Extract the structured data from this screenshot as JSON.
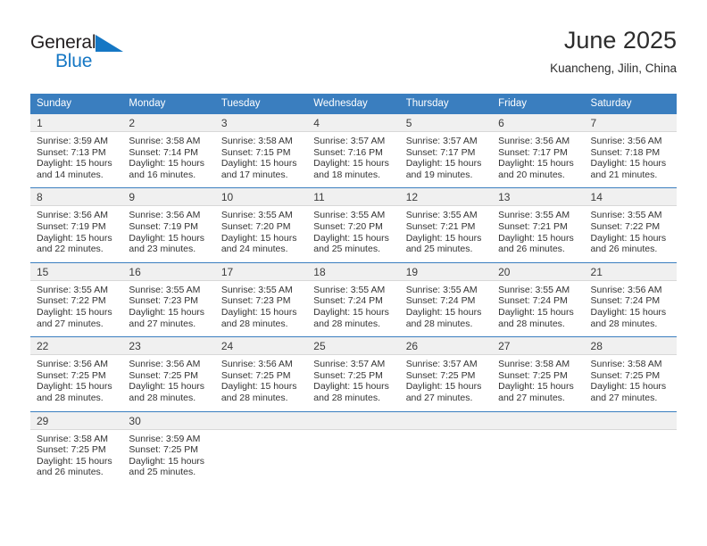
{
  "brand": {
    "name_top": "General",
    "name_bottom": "Blue",
    "triangle_color": "#1577c4",
    "text_color": "#231f20",
    "blue_color": "#1577c4"
  },
  "header": {
    "title": "June 2025",
    "subtitle": "Kuancheng, Jilin, China"
  },
  "colors": {
    "header_blue": "#3a7ebf",
    "daynum_bg": "#f0f0f0",
    "body_text": "#333333"
  },
  "calendar": {
    "weekday_headers": [
      "Sunday",
      "Monday",
      "Tuesday",
      "Wednesday",
      "Thursday",
      "Friday",
      "Saturday"
    ],
    "weeks": [
      {
        "days": [
          {
            "num": "1",
            "sunrise": "Sunrise: 3:59 AM",
            "sunset": "Sunset: 7:13 PM",
            "daylight1": "Daylight: 15 hours",
            "daylight2": "and 14 minutes."
          },
          {
            "num": "2",
            "sunrise": "Sunrise: 3:58 AM",
            "sunset": "Sunset: 7:14 PM",
            "daylight1": "Daylight: 15 hours",
            "daylight2": "and 16 minutes."
          },
          {
            "num": "3",
            "sunrise": "Sunrise: 3:58 AM",
            "sunset": "Sunset: 7:15 PM",
            "daylight1": "Daylight: 15 hours",
            "daylight2": "and 17 minutes."
          },
          {
            "num": "4",
            "sunrise": "Sunrise: 3:57 AM",
            "sunset": "Sunset: 7:16 PM",
            "daylight1": "Daylight: 15 hours",
            "daylight2": "and 18 minutes."
          },
          {
            "num": "5",
            "sunrise": "Sunrise: 3:57 AM",
            "sunset": "Sunset: 7:17 PM",
            "daylight1": "Daylight: 15 hours",
            "daylight2": "and 19 minutes."
          },
          {
            "num": "6",
            "sunrise": "Sunrise: 3:56 AM",
            "sunset": "Sunset: 7:17 PM",
            "daylight1": "Daylight: 15 hours",
            "daylight2": "and 20 minutes."
          },
          {
            "num": "7",
            "sunrise": "Sunrise: 3:56 AM",
            "sunset": "Sunset: 7:18 PM",
            "daylight1": "Daylight: 15 hours",
            "daylight2": "and 21 minutes."
          }
        ]
      },
      {
        "days": [
          {
            "num": "8",
            "sunrise": "Sunrise: 3:56 AM",
            "sunset": "Sunset: 7:19 PM",
            "daylight1": "Daylight: 15 hours",
            "daylight2": "and 22 minutes."
          },
          {
            "num": "9",
            "sunrise": "Sunrise: 3:56 AM",
            "sunset": "Sunset: 7:19 PM",
            "daylight1": "Daylight: 15 hours",
            "daylight2": "and 23 minutes."
          },
          {
            "num": "10",
            "sunrise": "Sunrise: 3:55 AM",
            "sunset": "Sunset: 7:20 PM",
            "daylight1": "Daylight: 15 hours",
            "daylight2": "and 24 minutes."
          },
          {
            "num": "11",
            "sunrise": "Sunrise: 3:55 AM",
            "sunset": "Sunset: 7:20 PM",
            "daylight1": "Daylight: 15 hours",
            "daylight2": "and 25 minutes."
          },
          {
            "num": "12",
            "sunrise": "Sunrise: 3:55 AM",
            "sunset": "Sunset: 7:21 PM",
            "daylight1": "Daylight: 15 hours",
            "daylight2": "and 25 minutes."
          },
          {
            "num": "13",
            "sunrise": "Sunrise: 3:55 AM",
            "sunset": "Sunset: 7:21 PM",
            "daylight1": "Daylight: 15 hours",
            "daylight2": "and 26 minutes."
          },
          {
            "num": "14",
            "sunrise": "Sunrise: 3:55 AM",
            "sunset": "Sunset: 7:22 PM",
            "daylight1": "Daylight: 15 hours",
            "daylight2": "and 26 minutes."
          }
        ]
      },
      {
        "days": [
          {
            "num": "15",
            "sunrise": "Sunrise: 3:55 AM",
            "sunset": "Sunset: 7:22 PM",
            "daylight1": "Daylight: 15 hours",
            "daylight2": "and 27 minutes."
          },
          {
            "num": "16",
            "sunrise": "Sunrise: 3:55 AM",
            "sunset": "Sunset: 7:23 PM",
            "daylight1": "Daylight: 15 hours",
            "daylight2": "and 27 minutes."
          },
          {
            "num": "17",
            "sunrise": "Sunrise: 3:55 AM",
            "sunset": "Sunset: 7:23 PM",
            "daylight1": "Daylight: 15 hours",
            "daylight2": "and 28 minutes."
          },
          {
            "num": "18",
            "sunrise": "Sunrise: 3:55 AM",
            "sunset": "Sunset: 7:24 PM",
            "daylight1": "Daylight: 15 hours",
            "daylight2": "and 28 minutes."
          },
          {
            "num": "19",
            "sunrise": "Sunrise: 3:55 AM",
            "sunset": "Sunset: 7:24 PM",
            "daylight1": "Daylight: 15 hours",
            "daylight2": "and 28 minutes."
          },
          {
            "num": "20",
            "sunrise": "Sunrise: 3:55 AM",
            "sunset": "Sunset: 7:24 PM",
            "daylight1": "Daylight: 15 hours",
            "daylight2": "and 28 minutes."
          },
          {
            "num": "21",
            "sunrise": "Sunrise: 3:56 AM",
            "sunset": "Sunset: 7:24 PM",
            "daylight1": "Daylight: 15 hours",
            "daylight2": "and 28 minutes."
          }
        ]
      },
      {
        "days": [
          {
            "num": "22",
            "sunrise": "Sunrise: 3:56 AM",
            "sunset": "Sunset: 7:25 PM",
            "daylight1": "Daylight: 15 hours",
            "daylight2": "and 28 minutes."
          },
          {
            "num": "23",
            "sunrise": "Sunrise: 3:56 AM",
            "sunset": "Sunset: 7:25 PM",
            "daylight1": "Daylight: 15 hours",
            "daylight2": "and 28 minutes."
          },
          {
            "num": "24",
            "sunrise": "Sunrise: 3:56 AM",
            "sunset": "Sunset: 7:25 PM",
            "daylight1": "Daylight: 15 hours",
            "daylight2": "and 28 minutes."
          },
          {
            "num": "25",
            "sunrise": "Sunrise: 3:57 AM",
            "sunset": "Sunset: 7:25 PM",
            "daylight1": "Daylight: 15 hours",
            "daylight2": "and 28 minutes."
          },
          {
            "num": "26",
            "sunrise": "Sunrise: 3:57 AM",
            "sunset": "Sunset: 7:25 PM",
            "daylight1": "Daylight: 15 hours",
            "daylight2": "and 27 minutes."
          },
          {
            "num": "27",
            "sunrise": "Sunrise: 3:58 AM",
            "sunset": "Sunset: 7:25 PM",
            "daylight1": "Daylight: 15 hours",
            "daylight2": "and 27 minutes."
          },
          {
            "num": "28",
            "sunrise": "Sunrise: 3:58 AM",
            "sunset": "Sunset: 7:25 PM",
            "daylight1": "Daylight: 15 hours",
            "daylight2": "and 27 minutes."
          }
        ]
      },
      {
        "days": [
          {
            "num": "29",
            "sunrise": "Sunrise: 3:58 AM",
            "sunset": "Sunset: 7:25 PM",
            "daylight1": "Daylight: 15 hours",
            "daylight2": "and 26 minutes."
          },
          {
            "num": "30",
            "sunrise": "Sunrise: 3:59 AM",
            "sunset": "Sunset: 7:25 PM",
            "daylight1": "Daylight: 15 hours",
            "daylight2": "and 25 minutes."
          },
          {
            "num": "",
            "sunrise": "",
            "sunset": "",
            "daylight1": "",
            "daylight2": ""
          },
          {
            "num": "",
            "sunrise": "",
            "sunset": "",
            "daylight1": "",
            "daylight2": ""
          },
          {
            "num": "",
            "sunrise": "",
            "sunset": "",
            "daylight1": "",
            "daylight2": ""
          },
          {
            "num": "",
            "sunrise": "",
            "sunset": "",
            "daylight1": "",
            "daylight2": ""
          },
          {
            "num": "",
            "sunrise": "",
            "sunset": "",
            "daylight1": "",
            "daylight2": ""
          }
        ]
      }
    ]
  }
}
